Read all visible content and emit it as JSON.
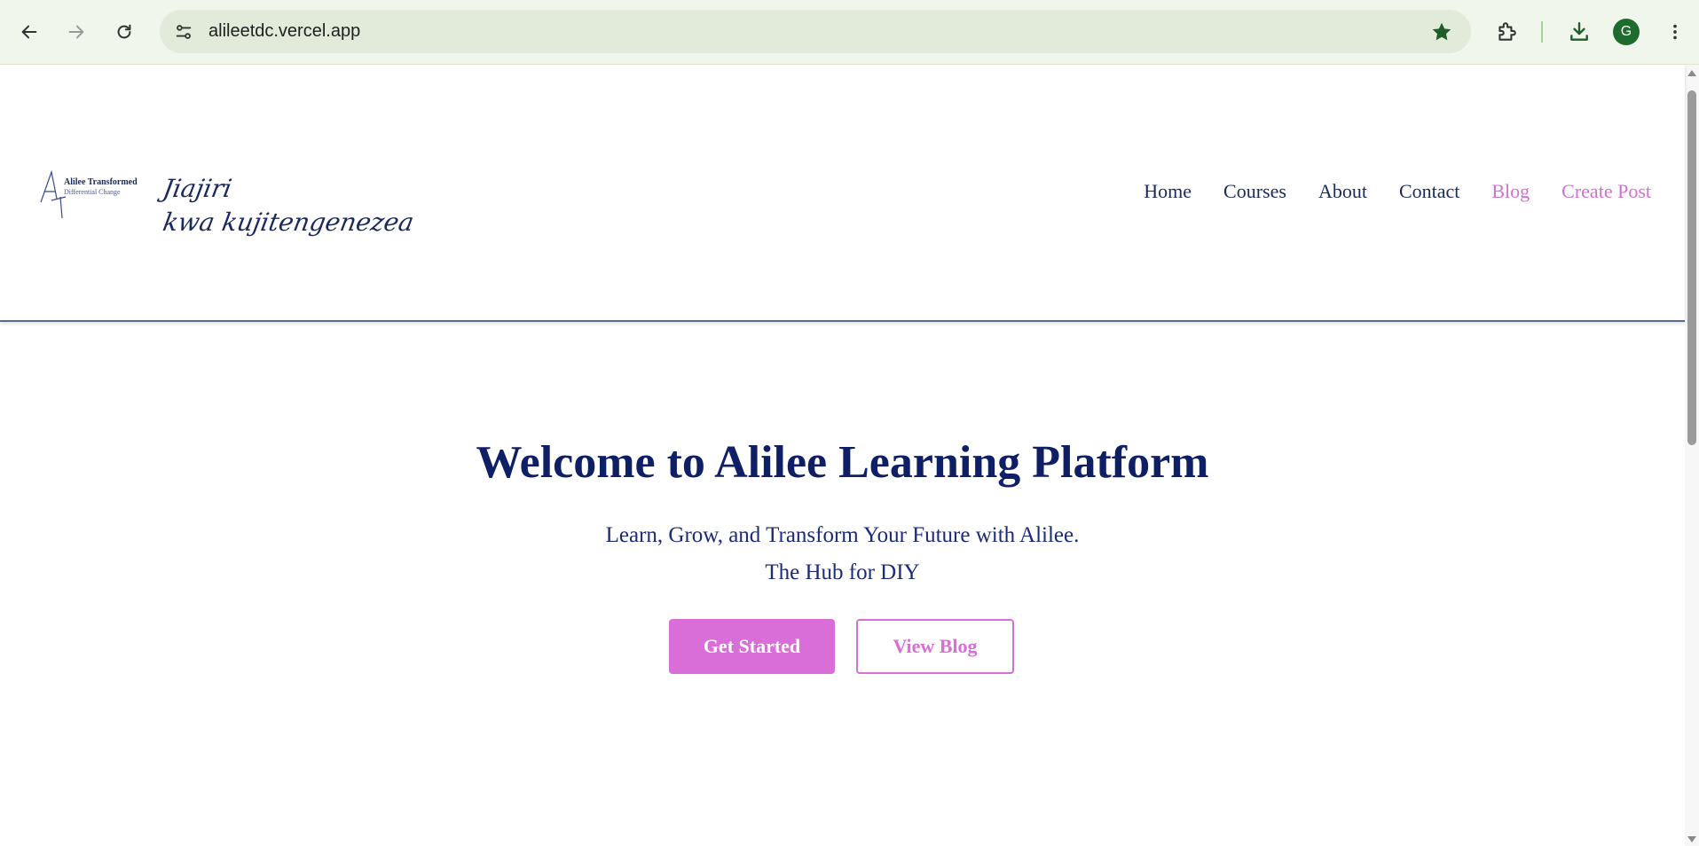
{
  "browser": {
    "url": "alileetdc.vercel.app",
    "profile_initial": "G",
    "icons": {
      "back": "back-arrow-icon",
      "forward": "forward-arrow-icon",
      "reload": "reload-icon",
      "site_info": "tune-icon",
      "bookmark": "star-icon",
      "extensions": "puzzle-icon",
      "downloads": "download-icon",
      "menu": "kebab-menu-icon"
    }
  },
  "site": {
    "logo": {
      "brand_line1": "Alilee Transformed",
      "brand_line2": "Differential Change",
      "tagline_line1": "Jiajiri",
      "tagline_line2": "kwa kujitengenezea"
    },
    "nav": [
      {
        "label": "Home"
      },
      {
        "label": "Courses"
      },
      {
        "label": "About"
      },
      {
        "label": "Contact"
      },
      {
        "label": "Blog"
      },
      {
        "label": "Create Post"
      }
    ],
    "hero": {
      "title": "Welcome to Alilee Learning Platform",
      "subtitle_line1": "Learn, Grow, and Transform Your Future with Alilee.",
      "subtitle_line2": "The Hub for DIY",
      "primary_button": "Get Started",
      "secondary_button": "View Blog"
    }
  },
  "colors": {
    "navy": "#0f1f66",
    "pink": "#d96ed8",
    "chrome_bg": "#f1f6ec",
    "omnibox_bg": "#e2ebd9"
  }
}
